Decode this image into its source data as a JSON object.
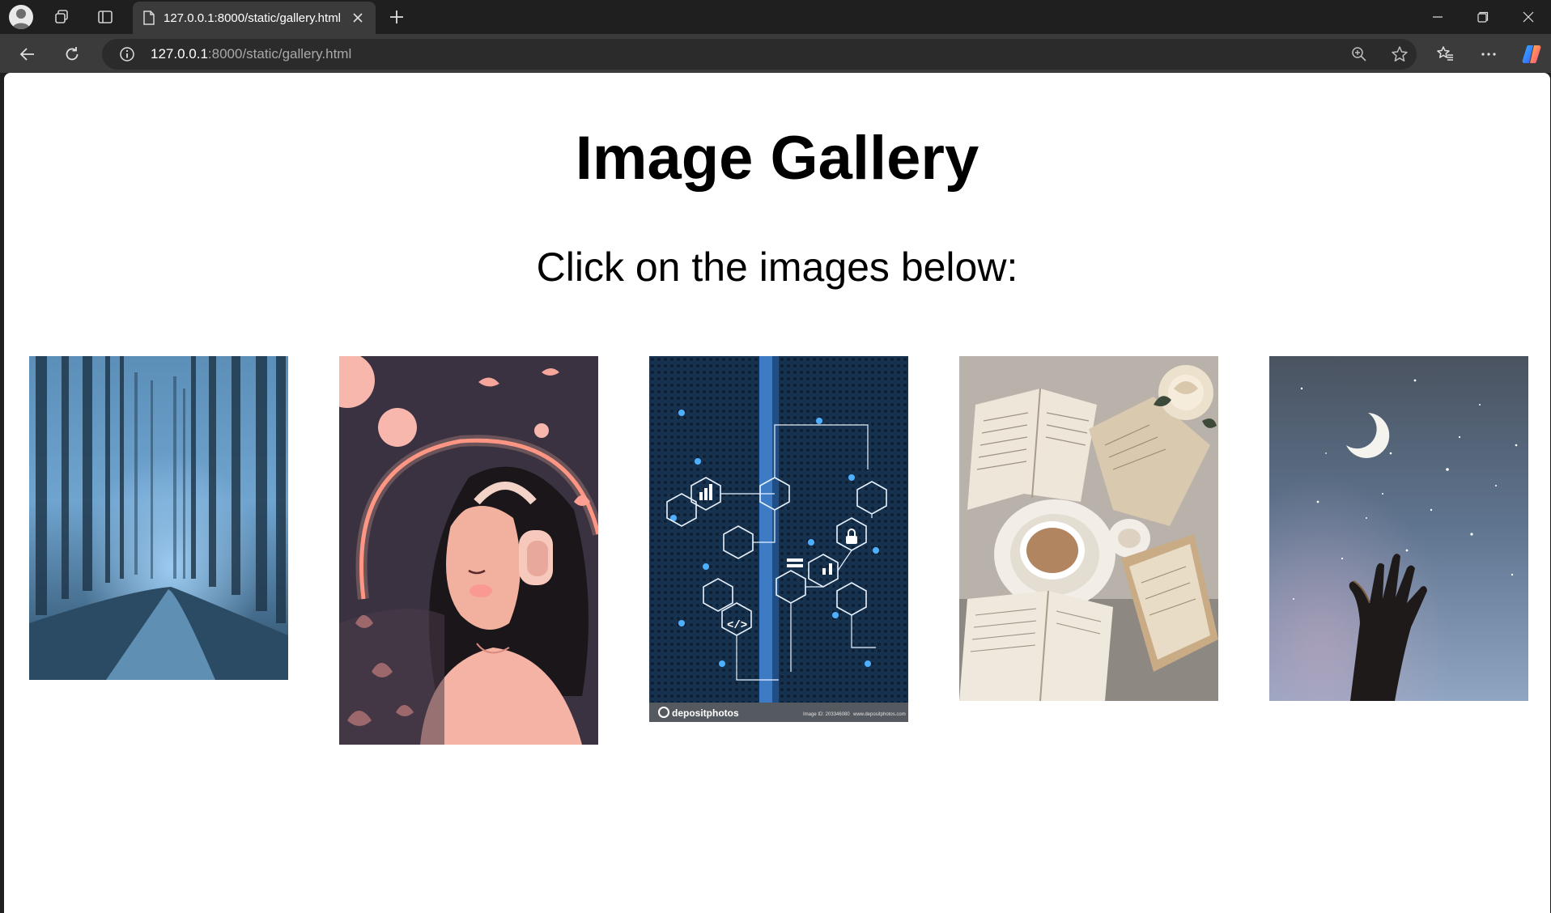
{
  "browser": {
    "tab_title": "127.0.0.1:8000/static/gallery.html",
    "url_host": "127.0.0.1",
    "url_path": ":8000/static/gallery.html"
  },
  "page": {
    "title": "Image Gallery",
    "subtitle": "Click on the images below:"
  },
  "gallery": {
    "images": [
      {
        "subject": "misty blue forest road"
      },
      {
        "subject": "anime girl with headphones and pink flowers"
      },
      {
        "subject": "server rack with network icons",
        "watermark_brand": "depositphotos",
        "watermark_id": "Image ID: 203346080",
        "watermark_site": "www.depositphotos.com"
      },
      {
        "subject": "open books with cup of coffee and roses"
      },
      {
        "subject": "hand reaching toward crescent moon in night sky"
      }
    ]
  },
  "colors": {
    "chrome_dark": "#1f1f1f",
    "chrome_toolbar": "#3b3b3b",
    "address_bg": "#2b2b2b",
    "page_bg": "#ffffff"
  }
}
